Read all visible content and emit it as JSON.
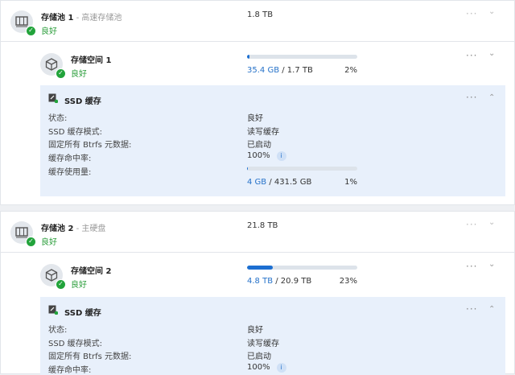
{
  "pools": [
    {
      "name": "存储池 1",
      "sep": " - ",
      "type": "高速存储池",
      "status": "良好",
      "size": "1.8 TB",
      "volume": {
        "name": "存储空间 1",
        "status": "良好",
        "used": "35.4 GB",
        "total": " / 1.7 TB",
        "percent": "2%",
        "fill": 2
      },
      "ssd": {
        "title": "SSD 缓存",
        "labels": [
          "状态:",
          "SSD 缓存模式:",
          "固定所有 Btrfs 元数据:",
          "缓存命中率:",
          "缓存使用量:"
        ],
        "values": [
          "良好",
          "读写缓存",
          "已启动",
          "100%"
        ],
        "used": "4 GB",
        "total": " / 431.5 GB",
        "percent": "1%",
        "fill": 1
      }
    },
    {
      "name": "存储池 2",
      "sep": " - ",
      "type": "主硬盘",
      "status": "良好",
      "size": "21.8 TB",
      "volume": {
        "name": "存储空间 2",
        "status": "良好",
        "used": "4.8 TB",
        "total": " / 20.9 TB",
        "percent": "23%",
        "fill": 23
      },
      "ssd": {
        "title": "SSD 缓存",
        "labels": [
          "状态:",
          "SSD 缓存模式:",
          "固定所有 Btrfs 元数据:",
          "缓存命中率:"
        ],
        "values": [
          "良好",
          "读写缓存",
          "已启动",
          "100%"
        ]
      }
    }
  ],
  "more_glyph": "···",
  "chevron_down": "⌄",
  "chevron_up": "⌃",
  "info_glyph": "i",
  "check_glyph": "✓"
}
